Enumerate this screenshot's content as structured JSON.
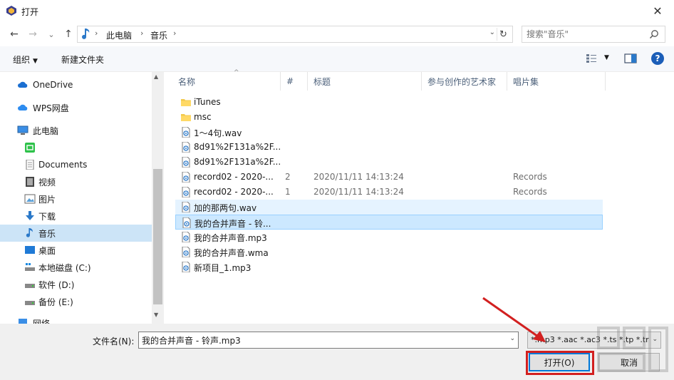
{
  "window": {
    "title": "打开",
    "close_glyph": "✕"
  },
  "nav": {
    "back_glyph": "←",
    "forward_glyph": "→",
    "recent_glyph": "⌄",
    "up_glyph": "↑",
    "breadcrumb": [
      "此电脑",
      "音乐"
    ],
    "sep_glyph": "›",
    "dropdown_glyph": "⌄",
    "refresh_glyph": "↻",
    "search_placeholder": "搜索\"音乐\""
  },
  "toolbar": {
    "organize_label": "组织",
    "new_folder_label": "新建文件夹",
    "caret_glyph": "▼",
    "help_glyph": "?"
  },
  "sidebar": {
    "items": [
      {
        "label": "OneDrive",
        "icon": "cloud-icon"
      },
      {
        "label": "WPS网盘",
        "icon": "wps-cloud-icon"
      },
      {
        "label": "此电脑",
        "icon": "computer-icon"
      },
      {
        "label": "",
        "icon": "green-app-icon"
      },
      {
        "label": "Documents",
        "icon": "document-icon"
      },
      {
        "label": "视频",
        "icon": "video-icon"
      },
      {
        "label": "图片",
        "icon": "picture-icon"
      },
      {
        "label": "下载",
        "icon": "download-icon"
      },
      {
        "label": "音乐",
        "icon": "music-icon"
      },
      {
        "label": "桌面",
        "icon": "desktop-icon"
      },
      {
        "label": "本地磁盘 (C:)",
        "icon": "system-drive-icon"
      },
      {
        "label": "软件 (D:)",
        "icon": "drive-icon"
      },
      {
        "label": "备份 (E:)",
        "icon": "drive-icon"
      },
      {
        "label": "网络",
        "icon": "network-icon"
      }
    ],
    "selected_index": 8
  },
  "columns": {
    "name": "名称",
    "number": "#",
    "title": "标题",
    "artists": "参与创作的艺术家",
    "album": "唱片集",
    "sort_glyph": "^"
  },
  "files": [
    {
      "name": "iTunes",
      "type": "folder",
      "number": "",
      "title": "",
      "album": ""
    },
    {
      "name": "msc",
      "type": "folder",
      "number": "",
      "title": "",
      "album": ""
    },
    {
      "name": "1～4句.wav",
      "type": "audio",
      "number": "",
      "title": "",
      "album": ""
    },
    {
      "name": "8d91%2F131a%2F...",
      "type": "audio",
      "number": "",
      "title": "",
      "album": ""
    },
    {
      "name": "8d91%2F131a%2F...",
      "type": "audio",
      "number": "",
      "title": "",
      "album": ""
    },
    {
      "name": "record02 - 2020-...",
      "type": "audio",
      "number": "2",
      "title": "2020/11/11 14:13:24",
      "album": "Records"
    },
    {
      "name": "record02 - 2020-...",
      "type": "audio",
      "number": "1",
      "title": "2020/11/11 14:13:24",
      "album": "Records"
    },
    {
      "name": "加的那两句.wav",
      "type": "audio",
      "number": "",
      "title": "",
      "album": ""
    },
    {
      "name": "我的合并声音 - 铃...",
      "type": "audio",
      "number": "",
      "title": "",
      "album": ""
    },
    {
      "name": "我的合并声音.mp3",
      "type": "audio",
      "number": "",
      "title": "",
      "album": ""
    },
    {
      "name": "我的合并声音.wma",
      "type": "audio",
      "number": "",
      "title": "",
      "album": ""
    },
    {
      "name": "新项目_1.mp3",
      "type": "audio",
      "number": "",
      "title": "",
      "album": ""
    }
  ],
  "hover_index": 7,
  "selected_index": 8,
  "footer": {
    "filename_label": "文件名(N):",
    "filename_value": "我的合并声音 - 铃声.mp3",
    "filetype_value": "*.mp3 *.aac *.ac3 *.ts *.tp *.tr",
    "open_label": "打开(O)",
    "cancel_label": "取消",
    "caret_glyph": "⌄"
  },
  "colors": {
    "accent": "#0078d7",
    "highlight": "#d22020",
    "selection": "#cce8ff"
  }
}
